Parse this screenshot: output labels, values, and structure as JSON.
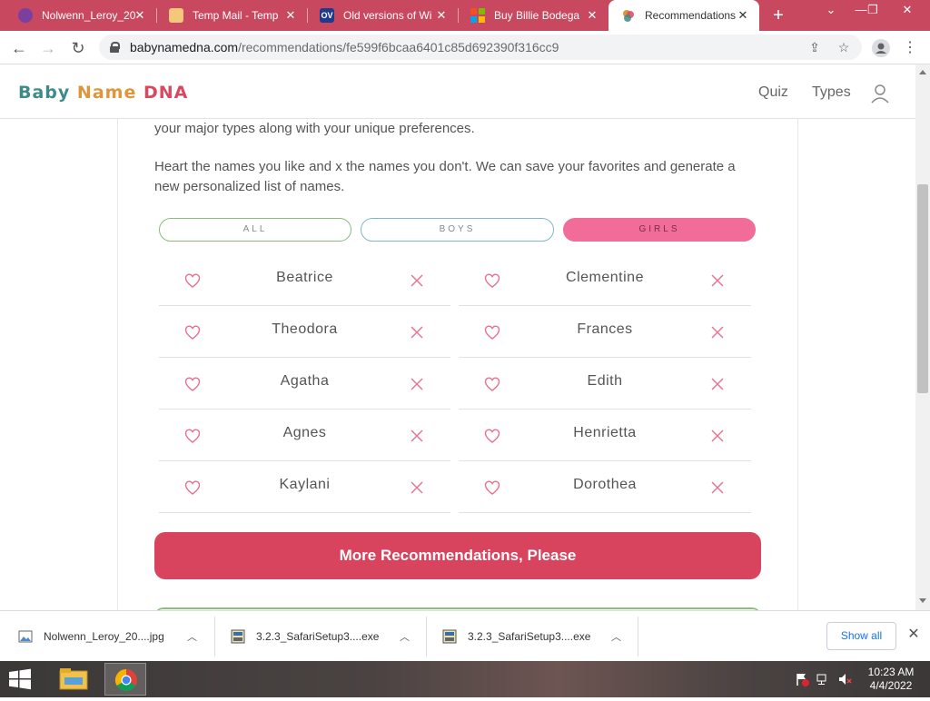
{
  "browser": {
    "tabs": [
      {
        "title": "Nolwenn_Leroy_20",
        "favicon": "firefox-like-icon"
      },
      {
        "title": "Temp Mail - Temp",
        "favicon": "envelope-icon"
      },
      {
        "title": "Old versions of Wi",
        "favicon": "ov-icon",
        "favicon_text": "OV"
      },
      {
        "title": "Buy Billie Bodega",
        "favicon": "microsoft-icon"
      },
      {
        "title": "Recommendations",
        "favicon": "babyname-icon",
        "active": true
      }
    ],
    "address": {
      "domain": "babynamedna.com",
      "path": "/recommendations/fe599f6bcaa6401c85d692390f316cc9"
    }
  },
  "site": {
    "logo": {
      "part1": "Baby",
      "part2": "Name",
      "part3": "DNA"
    },
    "nav": {
      "quiz": "Quiz",
      "types": "Types"
    }
  },
  "content": {
    "intro_tail": "your major types along with your unique preferences.",
    "instructions": "Heart the names you like and x the names you don't. We can save your favorites and generate a new personalized list of names.",
    "filters": {
      "all": "ALL",
      "boys": "BOYS",
      "girls": "GIRLS",
      "selected": "GIRLS"
    },
    "names_left": [
      "Beatrice",
      "Theodora",
      "Agatha",
      "Agnes",
      "Kaylani"
    ],
    "names_right": [
      "Clementine",
      "Frances",
      "Edith",
      "Henrietta",
      "Dorothea"
    ],
    "more_button": "More Recommendations, Please"
  },
  "downloads": {
    "items": [
      {
        "name": "Nolwenn_Leroy_20....jpg",
        "icon": "image-file-icon"
      },
      {
        "name": "3.2.3_SafariSetup3....exe",
        "icon": "installer-icon"
      },
      {
        "name": "3.2.3_SafariSetup3....exe",
        "icon": "installer-icon"
      }
    ],
    "show_all": "Show all"
  },
  "taskbar": {
    "time": "10:23 AM",
    "date": "4/4/2022"
  },
  "colors": {
    "tab_strip": "#c8485f",
    "accent_button": "#d8435e",
    "girls_filter": "#f26c9a",
    "heart": "#e8708f"
  }
}
